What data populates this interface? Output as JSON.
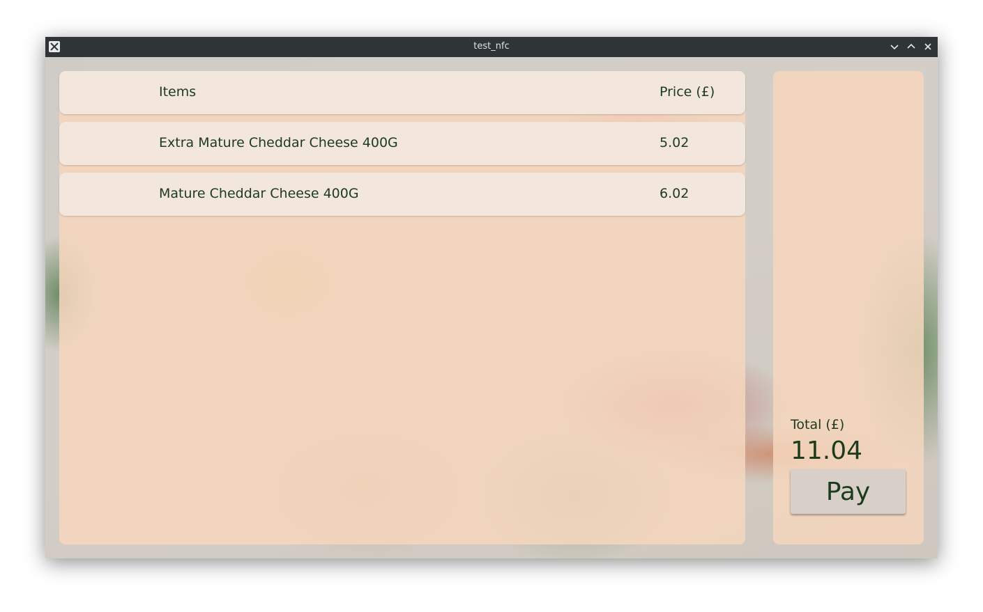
{
  "window": {
    "title": "test_nfc",
    "controls": [
      "minimize-icon",
      "maximize-icon",
      "close-icon"
    ]
  },
  "table": {
    "headers": {
      "items": "Items",
      "price": "Price (£)"
    },
    "rows": [
      {
        "name": "Extra Mature Cheddar Cheese 400G",
        "price": "5.02"
      },
      {
        "name": "Mature Cheddar Cheese 400G",
        "price": "6.02"
      }
    ]
  },
  "summary": {
    "total_label": "Total (£)",
    "total_value": "11.04",
    "pay_label": "Pay"
  },
  "colors": {
    "text": "#1c3b1c",
    "titlebar": "#2f3437",
    "panel": "#f6d6be",
    "button": "#d8cfc8"
  }
}
